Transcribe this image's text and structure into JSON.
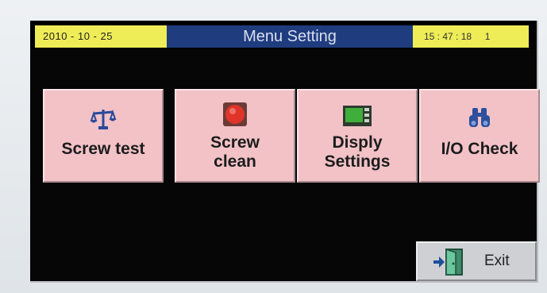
{
  "header": {
    "date": "2010 - 10 - 25",
    "title": "Menu Setting",
    "time": "15 : 47 : 18     1"
  },
  "menu": {
    "items": [
      {
        "label": "Screw test",
        "icon": "balance-scale-icon"
      },
      {
        "label": "Screw\nclean",
        "icon": "red-stop-icon"
      },
      {
        "label": "Disply\nSettings",
        "icon": "display-panel-icon"
      },
      {
        "label": "I/O Check",
        "icon": "binoculars-icon"
      }
    ]
  },
  "footer": {
    "exit_label": "Exit",
    "exit_icon": "exit-door-icon"
  },
  "colors": {
    "header_yellow": "#efed57",
    "header_blue": "#1f3c7e",
    "tile_pink": "#f2c2c7",
    "screen_black": "#060606",
    "exit_gray": "#cfd0d3"
  }
}
